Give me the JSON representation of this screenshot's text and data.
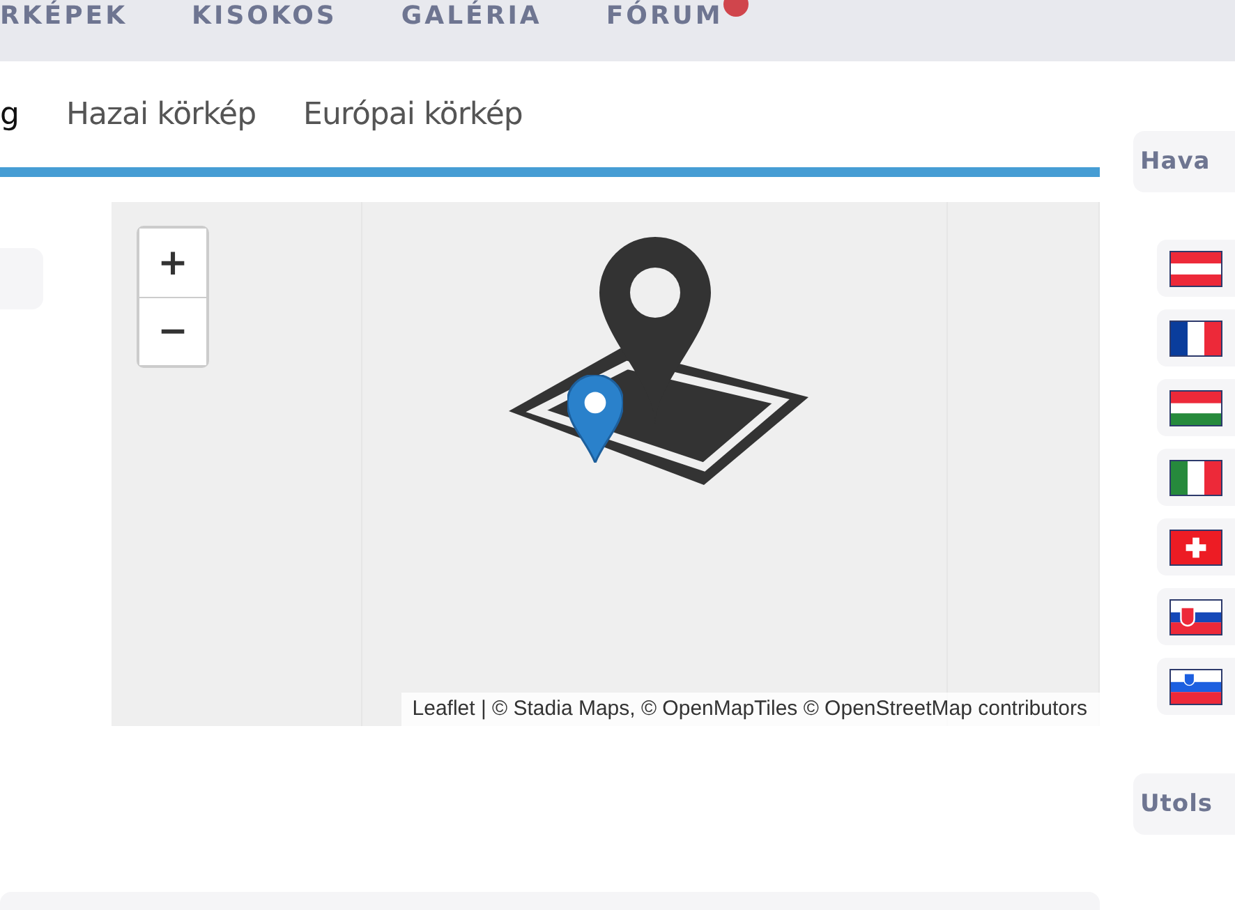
{
  "nav": {
    "items": [
      {
        "label": "RKÉPEK",
        "badge": false
      },
      {
        "label": "KISOKOS",
        "badge": false
      },
      {
        "label": "GALÉRIA",
        "badge": false
      },
      {
        "label": "FÓRUM",
        "badge": true
      }
    ]
  },
  "tabs": [
    {
      "label": "g",
      "selected": true
    },
    {
      "label": "Hazai körkép",
      "selected": false
    },
    {
      "label": "Európai körkép",
      "selected": false
    }
  ],
  "map": {
    "zoom_in": "+",
    "zoom_out": "−",
    "attribution": "Leaflet | © Stadia Maps, © OpenMapTiles © OpenStreetMap contributors"
  },
  "sidebar": {
    "heading": "Hava",
    "countries": [
      {
        "kind": "austria"
      },
      {
        "kind": "france"
      },
      {
        "kind": "hungary"
      },
      {
        "kind": "italy"
      },
      {
        "kind": "switzerland"
      },
      {
        "kind": "slovakia"
      },
      {
        "kind": "slovenia"
      }
    ],
    "heading_2": "Utols"
  }
}
